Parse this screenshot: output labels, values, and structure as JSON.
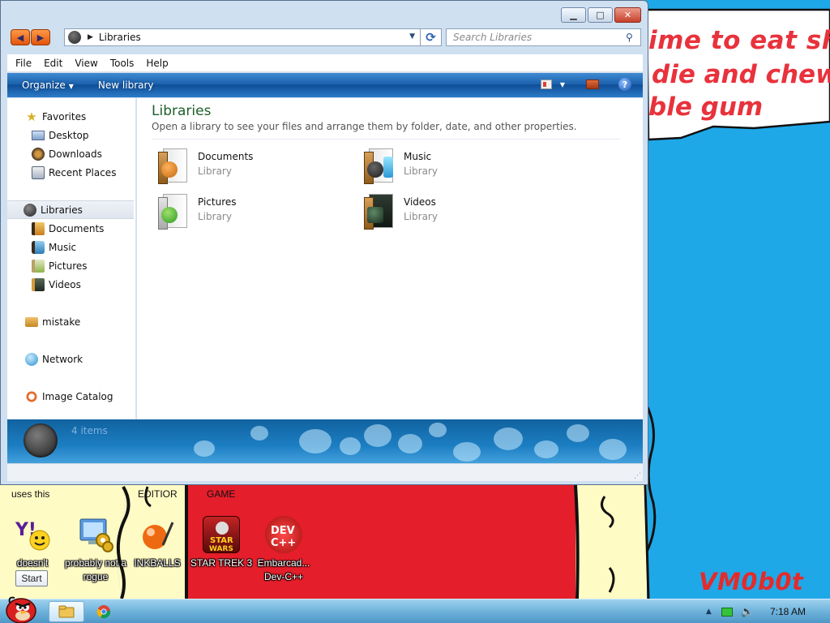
{
  "wallpaper": {
    "text_line1": "ime to eat shit",
    "text_line2": "die and chew",
    "text_line3": "ble gum",
    "signature": "VM0b0t",
    "labels": [
      "uses this",
      "EDITIOR",
      "GAME"
    ],
    "colors": {
      "sky": "#1fa8e8",
      "panel_red": "#e41e2a",
      "panel_cream": "#fffbc4",
      "text_red": "#e8323c"
    }
  },
  "desktop_icons": [
    {
      "label": "doesn't",
      "icon": "yahoo-messenger-icon"
    },
    {
      "label": "probably not a rogue",
      "icon": "monitor-gears-icon"
    },
    {
      "label": "INKBALLS",
      "icon": "inkball-icon"
    },
    {
      "label": "STAR TREK 3",
      "icon": "star-trek-icon"
    },
    {
      "label": "Embarcad... Dev-C++",
      "icon": "dev-cpp-icon"
    }
  ],
  "tooltip": "Start",
  "window": {
    "controls": {
      "minimize": "▁",
      "maximize": "□",
      "close": "✕"
    },
    "address": {
      "crumb": "Libraries"
    },
    "search": {
      "placeholder": "Search Libraries"
    },
    "menu": [
      "File",
      "Edit",
      "View",
      "Tools",
      "Help"
    ],
    "toolbar": {
      "organize": "Organize",
      "new_library": "New library"
    },
    "sidebar": {
      "favorites": {
        "label": "Favorites",
        "children": [
          "Desktop",
          "Downloads",
          "Recent Places"
        ]
      },
      "libraries": {
        "label": "Libraries",
        "children": [
          "Documents",
          "Music",
          "Pictures",
          "Videos"
        ]
      },
      "mistake": "mistake",
      "network": "Network",
      "image_catalog": "Image Catalog"
    },
    "content": {
      "title": "Libraries",
      "subtitle": "Open a library to see your files and arrange them by folder, date, and other properties.",
      "libraries": [
        {
          "name": "Documents",
          "kind": "Library",
          "icon": "documents-library-icon"
        },
        {
          "name": "Music",
          "kind": "Library",
          "icon": "music-library-icon"
        },
        {
          "name": "Pictures",
          "kind": "Library",
          "icon": "pictures-library-icon"
        },
        {
          "name": "Videos",
          "kind": "Library",
          "icon": "videos-library-icon"
        }
      ]
    },
    "details": {
      "count": "4 items"
    }
  },
  "taskbar": {
    "clock": "7:18 AM",
    "tasks": [
      "explorer-icon",
      "chrome-icon"
    ]
  }
}
